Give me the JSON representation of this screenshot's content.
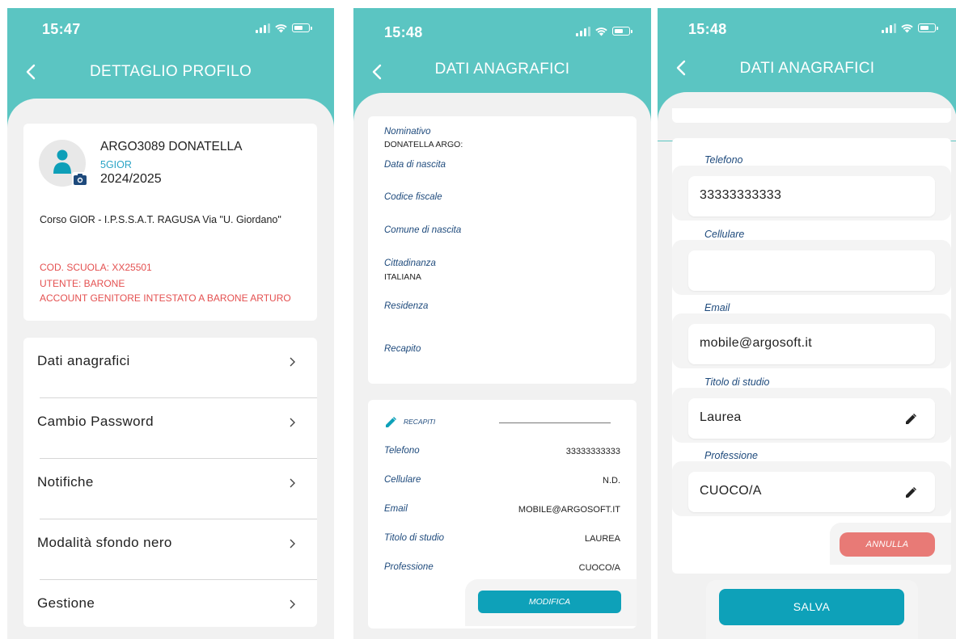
{
  "status": {
    "time1": "15:47",
    "time2": "15:48",
    "time3": "15:48"
  },
  "panel1": {
    "title": "DETTAGLIO PROFILO",
    "profile": {
      "name": "ARGO3089 DONATELLA",
      "class": "5GIOR",
      "year": "2024/2025",
      "course": "Corso GIOR - I.P.S.S.A.T. RAGUSA Via \"U. Giordano\"",
      "school_code": "COD. SCUOLA: XX25501",
      "user": "UTENTE: BARONE",
      "account": "ACCOUNT GENITORE INTESTATO A BARONE ARTURO"
    },
    "menu": [
      {
        "label": "Dati anagrafici"
      },
      {
        "label": "Cambio Password"
      },
      {
        "label": "Notifiche"
      },
      {
        "label": "Modalità sfondo nero"
      },
      {
        "label": "Gestione"
      }
    ]
  },
  "panel2": {
    "title": "DATI ANAGRAFICI",
    "fields": {
      "nominativo_label": "Nominativo",
      "nominativo_value": "DONATELLA ARGO:",
      "nascita_label": "Data di nascita",
      "codice_label": "Codice fiscale",
      "comune_label": "Comune di nascita",
      "cittadinanza_label": "Cittadinanza",
      "cittadinanza_value": "ITALIANA",
      "residenza_label": "Residenza",
      "recapito_label": "Recapito"
    },
    "recapiti": {
      "header": "RECAPITI",
      "rows": [
        {
          "label": "Telefono",
          "value": "33333333333"
        },
        {
          "label": "Cellulare",
          "value": "N.D."
        },
        {
          "label": "Email",
          "value": "MOBILE@ARGOSOFT.IT"
        },
        {
          "label": "Titolo di studio",
          "value": "LAUREA"
        },
        {
          "label": "Professione",
          "value": "CUOCO/A"
        }
      ],
      "modifica": "MODIFICA"
    }
  },
  "panel3": {
    "title": "DATI ANAGRAFICI",
    "telefono_label": "Telefono",
    "telefono_value": "33333333333",
    "cellulare_label": "Cellulare",
    "cellulare_value": "",
    "email_label": "Email",
    "email_value": "mobile@argosoft.it",
    "titolo_label": "Titolo di studio",
    "titolo_value": "Laurea",
    "professione_label": "Professione",
    "professione_value": "CUOCO/A",
    "annulla": "ANNULLA",
    "salva": "SALVA"
  },
  "colors": {
    "header": "#5bc5c2",
    "primary_button": "#0ea1b9",
    "cancel_button": "#e87a76",
    "alert_text": "#e45050",
    "field_label": "#1e4a7c"
  }
}
